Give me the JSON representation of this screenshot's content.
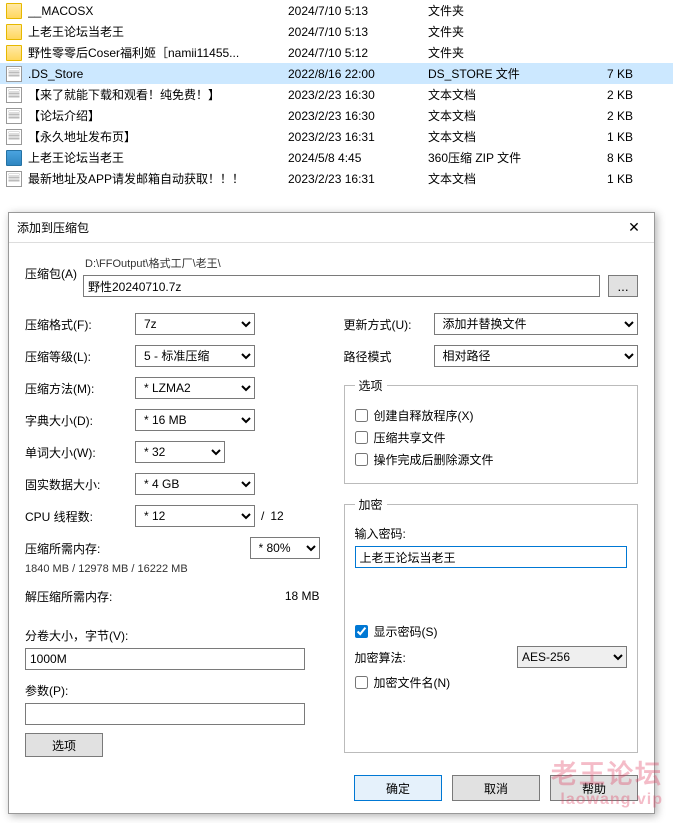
{
  "files": [
    {
      "icon": "folder",
      "name": "__MACOSX",
      "date": "2024/7/10 5:13",
      "type": "文件夹",
      "size": ""
    },
    {
      "icon": "folder",
      "name": "上老王论坛当老王",
      "date": "2024/7/10 5:13",
      "type": "文件夹",
      "size": ""
    },
    {
      "icon": "folder",
      "name": "野性零零后Coser福利姬［namii11455...",
      "date": "2024/7/10 5:12",
      "type": "文件夹",
      "size": ""
    },
    {
      "icon": "doc",
      "name": ".DS_Store",
      "date": "2022/8/16 22:00",
      "type": "DS_STORE 文件",
      "size": "7 KB",
      "selected": true
    },
    {
      "icon": "doc",
      "name": "【来了就能下载和观看！纯免费！】",
      "date": "2023/2/23 16:30",
      "type": "文本文档",
      "size": "2 KB"
    },
    {
      "icon": "doc",
      "name": "【论坛介绍】",
      "date": "2023/2/23 16:30",
      "type": "文本文档",
      "size": "2 KB"
    },
    {
      "icon": "doc",
      "name": "【永久地址发布页】",
      "date": "2023/2/23 16:31",
      "type": "文本文档",
      "size": "1 KB"
    },
    {
      "icon": "zip",
      "name": "上老王论坛当老王",
      "date": "2024/5/8 4:45",
      "type": "360压缩 ZIP 文件",
      "size": "8 KB"
    },
    {
      "icon": "doc",
      "name": "最新地址及APP请发邮箱自动获取！！！",
      "date": "2023/2/23 16:31",
      "type": "文本文档",
      "size": "1 KB"
    }
  ],
  "dialog": {
    "title": "添加到压缩包",
    "archive_label": "压缩包(A)",
    "archive_path": "D:\\FFOutput\\格式工厂\\老王\\",
    "archive_name": "野性20240710.7z",
    "browse": "...",
    "left": {
      "format_label": "压缩格式(F):",
      "format_value": "7z",
      "level_label": "压缩等级(L):",
      "level_value": "5 - 标准压缩",
      "method_label": "压缩方法(M):",
      "method_value": "* LZMA2",
      "dict_label": "字典大小(D):",
      "dict_value": "* 16 MB",
      "word_label": "单词大小(W):",
      "word_value": "* 32",
      "solid_label": "固实数据大小:",
      "solid_value": "* 4 GB",
      "cpu_label": "CPU 线程数:",
      "cpu_value": "* 12",
      "cpu_total": "12",
      "mem_comp_label": "压缩所需内存:",
      "mem_comp_value": "* 80%",
      "mem_info": "1840 MB / 12978 MB / 16222 MB",
      "mem_decomp_label": "解压缩所需内存:",
      "mem_decomp_value": "18 MB",
      "vol_label": "分卷大小，字节(V):",
      "vol_value": "1000M",
      "param_label": "参数(P):",
      "param_value": "",
      "options_btn": "选项"
    },
    "right": {
      "update_label": "更新方式(U):",
      "update_value": "添加并替换文件",
      "path_label": "路径模式",
      "path_value": "相对路径",
      "options_legend": "选项",
      "opt_sfx": "创建自释放程序(X)",
      "opt_share": "压缩共享文件",
      "opt_delete": "操作完成后删除源文件",
      "enc_legend": "加密",
      "pw_label": "输入密码:",
      "pw_value": "上老王论坛当老王",
      "show_pw": "显示密码(S)",
      "enc_method_label": "加密算法:",
      "enc_method_value": "AES-256",
      "enc_names": "加密文件名(N)"
    },
    "footer": {
      "ok": "确定",
      "cancel": "取消",
      "help": "帮助"
    }
  },
  "watermark": {
    "big": "老王论坛",
    "small": "laowang.vip"
  }
}
